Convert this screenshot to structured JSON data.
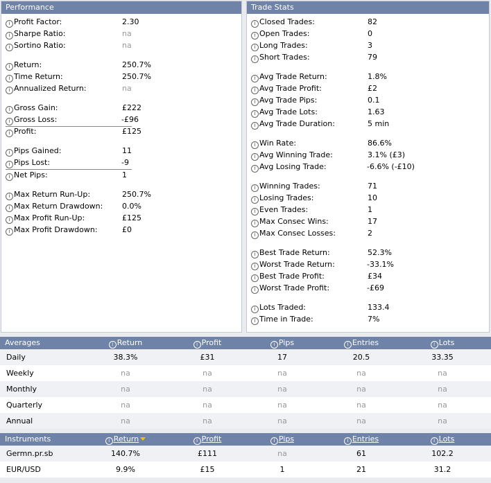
{
  "performance": {
    "title": "Performance",
    "rows": [
      {
        "label": "Profit Factor:",
        "value": "2.30"
      },
      {
        "label": "Sharpe Ratio:",
        "value": "na"
      },
      {
        "label": "Sortino Ratio:",
        "value": "na"
      },
      {
        "label": "Return:",
        "value": "250.7%"
      },
      {
        "label": "Time Return:",
        "value": "250.7%"
      },
      {
        "label": "Annualized Return:",
        "value": "na"
      },
      {
        "label": "Gross Gain:",
        "value": "£222"
      },
      {
        "label": "Gross Loss:",
        "value": "-£96"
      },
      {
        "label": "Profit:",
        "value": "£125"
      },
      {
        "label": "Pips Gained:",
        "value": "11"
      },
      {
        "label": "Pips Lost:",
        "value": "-9"
      },
      {
        "label": "Net Pips:",
        "value": "1"
      },
      {
        "label": "Max Return Run-Up:",
        "value": "250.7%"
      },
      {
        "label": "Max Return Drawdown:",
        "value": "0.0%"
      },
      {
        "label": "Max Profit Run-Up:",
        "value": "£125"
      },
      {
        "label": "Max Profit Drawdown:",
        "value": "£0"
      }
    ]
  },
  "trade_stats": {
    "title": "Trade Stats",
    "rows": [
      {
        "label": "Closed Trades:",
        "value": "82"
      },
      {
        "label": "Open Trades:",
        "value": "0"
      },
      {
        "label": "Long Trades:",
        "value": "3"
      },
      {
        "label": "Short Trades:",
        "value": "79"
      },
      {
        "label": "Avg Trade Return:",
        "value": "1.8%"
      },
      {
        "label": "Avg Trade Profit:",
        "value": "£2"
      },
      {
        "label": "Avg Trade Pips:",
        "value": "0.1"
      },
      {
        "label": "Avg Trade Lots:",
        "value": "1.63"
      },
      {
        "label": "Avg Trade Duration:",
        "value": "5 min"
      },
      {
        "label": "Win Rate:",
        "value": "86.6%"
      },
      {
        "label": "Avg Winning Trade:",
        "value": "3.1% (£3)"
      },
      {
        "label": "Avg Losing Trade:",
        "value": "-6.6% (-£10)"
      },
      {
        "label": "Winning Trades:",
        "value": "71"
      },
      {
        "label": "Losing Trades:",
        "value": "10"
      },
      {
        "label": "Even Trades:",
        "value": "1"
      },
      {
        "label": "Max Consec Wins:",
        "value": "17"
      },
      {
        "label": "Max Consec Losses:",
        "value": "2"
      },
      {
        "label": "Best Trade Return:",
        "value": "52.3%"
      },
      {
        "label": "Worst Trade Return:",
        "value": "-33.1%"
      },
      {
        "label": "Best Trade Profit:",
        "value": "£34"
      },
      {
        "label": "Worst Trade Profit:",
        "value": "-£69"
      },
      {
        "label": "Lots Traded:",
        "value": "133.4"
      },
      {
        "label": "Time in Trade:",
        "value": "7%"
      }
    ]
  },
  "averages": {
    "title": "Averages",
    "columns": [
      "Return",
      "Profit",
      "Pips",
      "Entries",
      "Lots"
    ],
    "rows": [
      {
        "label": "Daily",
        "values": [
          "38.3%",
          "£31",
          "17",
          "20.5",
          "33.35"
        ]
      },
      {
        "label": "Weekly",
        "values": [
          "na",
          "na",
          "na",
          "na",
          "na"
        ]
      },
      {
        "label": "Monthly",
        "values": [
          "na",
          "na",
          "na",
          "na",
          "na"
        ]
      },
      {
        "label": "Quarterly",
        "values": [
          "na",
          "na",
          "na",
          "na",
          "na"
        ]
      },
      {
        "label": "Annual",
        "values": [
          "na",
          "na",
          "na",
          "na",
          "na"
        ]
      }
    ]
  },
  "instruments": {
    "title": "Instruments",
    "columns": [
      "Return",
      "Profit",
      "Pips",
      "Entries",
      "Lots"
    ],
    "rows": [
      {
        "label": "Germn.pr.sb",
        "values": [
          "140.7%",
          "£111",
          "na",
          "61",
          "102.2"
        ]
      },
      {
        "label": "EUR/USD",
        "values": [
          "9.9%",
          "£15",
          "1",
          "21",
          "31.2"
        ]
      }
    ]
  },
  "icons": {
    "info": "info-icon",
    "sort": "sort-down-arrow-icon"
  },
  "colors": {
    "header": "#6f83a8",
    "na": "#999999",
    "sort_arrow": "#f2c200"
  }
}
